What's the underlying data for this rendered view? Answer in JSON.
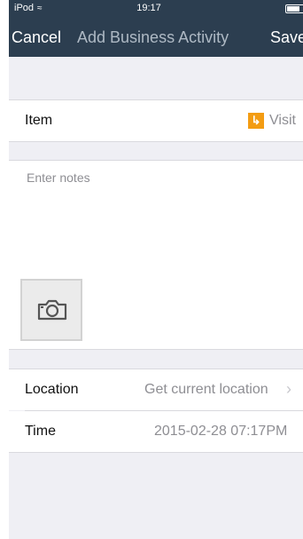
{
  "status_bar": {
    "carrier": "iPod",
    "time": "19:17"
  },
  "nav": {
    "cancel_label": "Cancel",
    "title": "Add Business Activity",
    "save_label": "Save"
  },
  "item": {
    "label": "Item",
    "value": "Visit",
    "icon": "visit-icon",
    "icon_color": "#f39c12"
  },
  "notes": {
    "placeholder": "Enter notes",
    "value": ""
  },
  "location": {
    "label": "Location",
    "value": "Get current location"
  },
  "time": {
    "label": "Time",
    "value": "2015-02-28 07:17PM"
  },
  "colors": {
    "navbar": "#2c3e50",
    "background": "#efeff4"
  }
}
